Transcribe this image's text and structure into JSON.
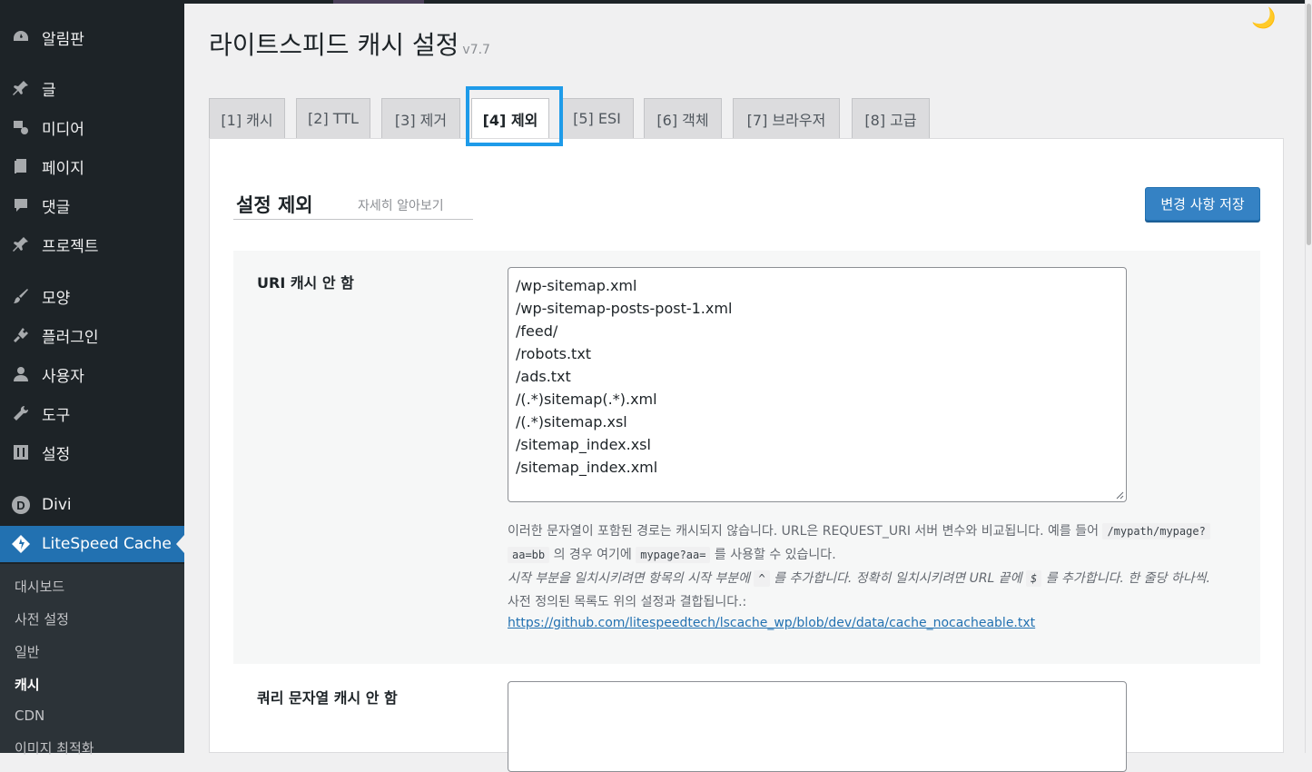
{
  "sidebar": {
    "items": [
      {
        "label": "알림판",
        "icon": "dashboard-icon"
      },
      {
        "label": "글",
        "icon": "pin-icon"
      },
      {
        "label": "미디어",
        "icon": "media-icon"
      },
      {
        "label": "페이지",
        "icon": "page-icon"
      },
      {
        "label": "댓글",
        "icon": "comment-icon"
      },
      {
        "label": "프로젝트",
        "icon": "pin-icon"
      },
      {
        "label": "모양",
        "icon": "brush-icon"
      },
      {
        "label": "플러그인",
        "icon": "plugin-icon"
      },
      {
        "label": "사용자",
        "icon": "user-icon"
      },
      {
        "label": "도구",
        "icon": "wrench-icon"
      },
      {
        "label": "설정",
        "icon": "settings-icon"
      },
      {
        "label": "Divi",
        "icon": "divi-icon"
      },
      {
        "label": "LiteSpeed Cache",
        "icon": "litespeed-icon"
      }
    ],
    "submenu": [
      "대시보드",
      "사전 설정",
      "일반",
      "캐시",
      "CDN",
      "이미지 최적화"
    ]
  },
  "header": {
    "title": "라이트스피드 캐시 설정",
    "version": "v7.7"
  },
  "tabs": [
    "[1] 캐시",
    "[2] TTL",
    "[3] 제거",
    "[4] 제외",
    "[5] ESI",
    "[6] 객체",
    "[7] 브라우저",
    "[8] 고급"
  ],
  "active_tab": "[4] 제외",
  "section": {
    "title": "설정 제외",
    "learn_more": "자세히 알아보기",
    "save_label": "변경 사항 저장"
  },
  "fields": {
    "uri": {
      "label": "URI 캐시 안 함",
      "lines": [
        "/wp-sitemap.xml",
        "/wp-sitemap-posts-post-1.xml",
        "/feed/",
        "/robots.txt",
        "/ads.txt",
        "/(.*)sitemap(.*).xml",
        "/(.*)sitemap.xsl",
        "/sitemap_index.xsl",
        "/sitemap_index.xml"
      ],
      "desc1_a": "이러한 문자열이 포함된 경로는 캐시되지 않습니다. URL은 REQUEST_URI 서버 변수와 비교됩니다. 예를 들어",
      "desc1_code": "/mypath/mypage?",
      "desc2_code1": "aa=bb",
      "desc2_text1": "의 경우 여기에",
      "desc2_code2": "mypage?aa=",
      "desc2_text2": "를 사용할 수 있습니다.",
      "desc3_a": "시작 부분을 일치시키려면 항목의 시작 부분에",
      "desc3_code1": "^",
      "desc3_b": "를 추가합니다. 정확히 일치시키려면 URL 끝에",
      "desc3_code2": "$",
      "desc3_c": "를 추가합니다. 한 줄당 하나씩.",
      "desc4": "사전 정의된 목록도 위의 설정과 결합됩니다.:",
      "link": "https://github.com/litespeedtech/lscache_wp/blob/dev/data/cache_nocacheable.txt"
    },
    "query": {
      "label": "쿼리 문자열 캐시 안 함",
      "value": ""
    }
  }
}
